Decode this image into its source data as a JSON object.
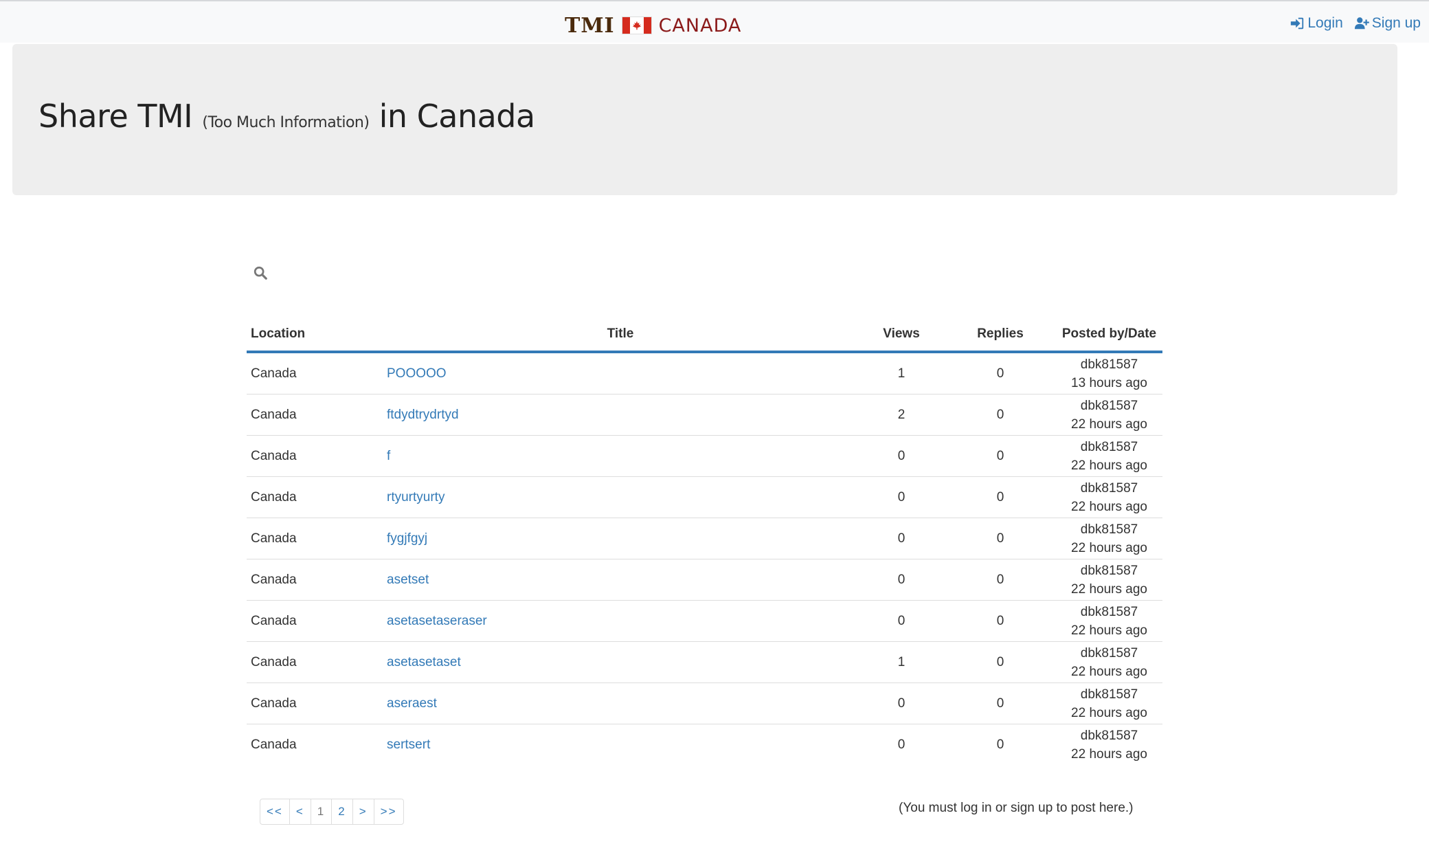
{
  "brand": {
    "tmi": "TMI",
    "country": "CANADA",
    "flag_colors": {
      "red": "#d52b1e",
      "white": "#ffffff"
    }
  },
  "nav": {
    "login": "Login",
    "signup": "Sign up"
  },
  "hero": {
    "title_main": "Share TMI",
    "title_small": "(Too Much Information)",
    "title_suffix": "in Canada"
  },
  "search": {
    "icon": "search-icon"
  },
  "table": {
    "headers": {
      "location": "Location",
      "title": "Title",
      "views": "Views",
      "replies": "Replies",
      "posted": "Posted by/Date"
    },
    "rows": [
      {
        "location": "Canada",
        "title": "POOOOO",
        "views": "1",
        "replies": "0",
        "user": "dbk81587",
        "date": "13 hours ago"
      },
      {
        "location": "Canada",
        "title": "ftdydtrydrtyd",
        "views": "2",
        "replies": "0",
        "user": "dbk81587",
        "date": "22 hours ago"
      },
      {
        "location": "Canada",
        "title": "f",
        "views": "0",
        "replies": "0",
        "user": "dbk81587",
        "date": "22 hours ago"
      },
      {
        "location": "Canada",
        "title": "rtyurtyurty",
        "views": "0",
        "replies": "0",
        "user": "dbk81587",
        "date": "22 hours ago"
      },
      {
        "location": "Canada",
        "title": "fygjfgyj",
        "views": "0",
        "replies": "0",
        "user": "dbk81587",
        "date": "22 hours ago"
      },
      {
        "location": "Canada",
        "title": "asetset",
        "views": "0",
        "replies": "0",
        "user": "dbk81587",
        "date": "22 hours ago"
      },
      {
        "location": "Canada",
        "title": "asetasetaseraser",
        "views": "0",
        "replies": "0",
        "user": "dbk81587",
        "date": "22 hours ago"
      },
      {
        "location": "Canada",
        "title": "asetasetaset",
        "views": "1",
        "replies": "0",
        "user": "dbk81587",
        "date": "22 hours ago"
      },
      {
        "location": "Canada",
        "title": "aseraest",
        "views": "0",
        "replies": "0",
        "user": "dbk81587",
        "date": "22 hours ago"
      },
      {
        "location": "Canada",
        "title": "sertsert",
        "views": "0",
        "replies": "0",
        "user": "dbk81587",
        "date": "22 hours ago"
      }
    ]
  },
  "pagination": {
    "first": "<<",
    "prev": "<",
    "page1": "1",
    "page2": "2",
    "next": ">",
    "last": ">>",
    "current_page": 1
  },
  "notice": "(You must log in or sign up to post here.)",
  "colors": {
    "link": "#337ab7",
    "accent_border": "#337ab7",
    "jumbotron_bg": "#eeeeee",
    "navbar_bg": "#f8f9fa"
  }
}
